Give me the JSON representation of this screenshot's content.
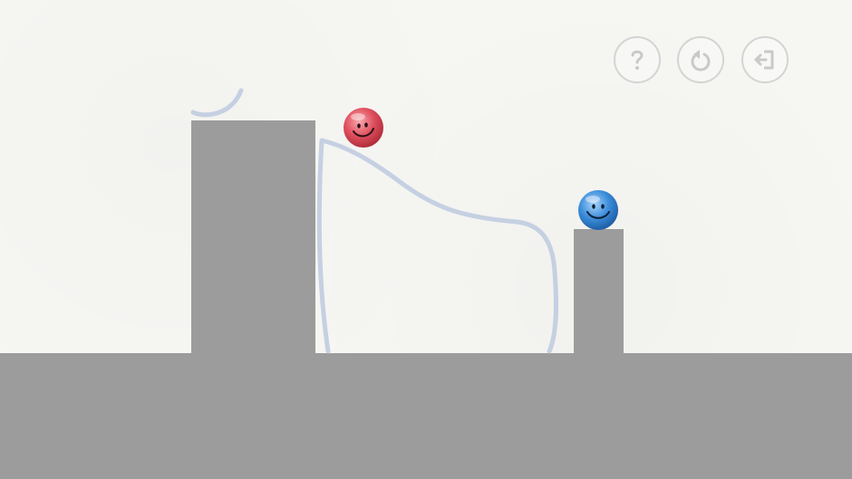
{
  "scene": {
    "background_color": "#f6f6f3",
    "block_color": "#9c9c9c",
    "drawn_line_color": "#c5d0e2"
  },
  "hud": {
    "help_icon": "question-icon",
    "restart_icon": "restart-icon",
    "exit_icon": "exit-icon",
    "icon_color": "#c9c9c9"
  },
  "balls": {
    "red": {
      "color": "#e0505e",
      "face": "smiley"
    },
    "blue": {
      "color": "#3d8fdc",
      "face": "smiley"
    }
  }
}
